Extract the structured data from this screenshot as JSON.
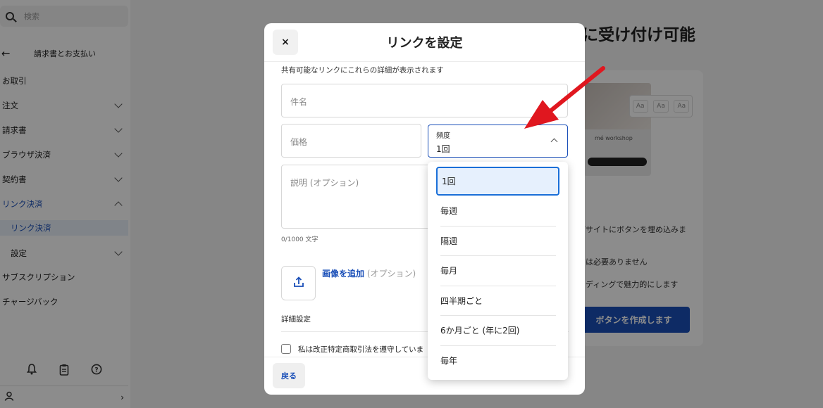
{
  "sidebar": {
    "search_placeholder": "検索",
    "back_label": "請求書とお支払い",
    "items": [
      {
        "label": "お取引"
      },
      {
        "label": "注文"
      },
      {
        "label": "請求書"
      },
      {
        "label": "ブラウザ決済"
      },
      {
        "label": "契約書"
      },
      {
        "label": "リンク決済"
      },
      {
        "label": "リンク決済"
      },
      {
        "label": "設定"
      },
      {
        "label": "サブスクリプション"
      },
      {
        "label": "チャージバック"
      }
    ]
  },
  "background": {
    "heading": "に受け付け可能",
    "workshop": "mé workshop",
    "font_samples": [
      "Aa",
      "Aa",
      "Aa"
    ],
    "text_1": "ブサイトにボタンを埋め込みま",
    "text_2": "アは必要ありません",
    "text_3": "ンディングで魅力的にします",
    "cta": "ボタンを作成します"
  },
  "modal": {
    "close_symbol": "×",
    "title": "リンクを設定",
    "caption": "共有可能なリンクにこれらの詳細が表示されます",
    "subject_placeholder": "件名",
    "price_placeholder": "価格",
    "frequency_label": "頻度",
    "frequency_value": "1回",
    "description_placeholder": "説明 (オプション)",
    "char_count": "0/1000 文字",
    "add_image_link": "画像を追加",
    "add_image_optional": " (オプション)",
    "detail_settings": "詳細設定",
    "compliance_checkbox": "私は改正特定商取引法を遵守していま",
    "back_button": "戻る"
  },
  "dropdown": {
    "options": [
      "1回",
      "毎週",
      "隔週",
      "毎月",
      "四半期ごと",
      "6か月ごと (年に2回)",
      "毎年"
    ],
    "selected_index": 0
  },
  "colors": {
    "accent": "#1a4fb8",
    "arrow": "#e0171f"
  }
}
